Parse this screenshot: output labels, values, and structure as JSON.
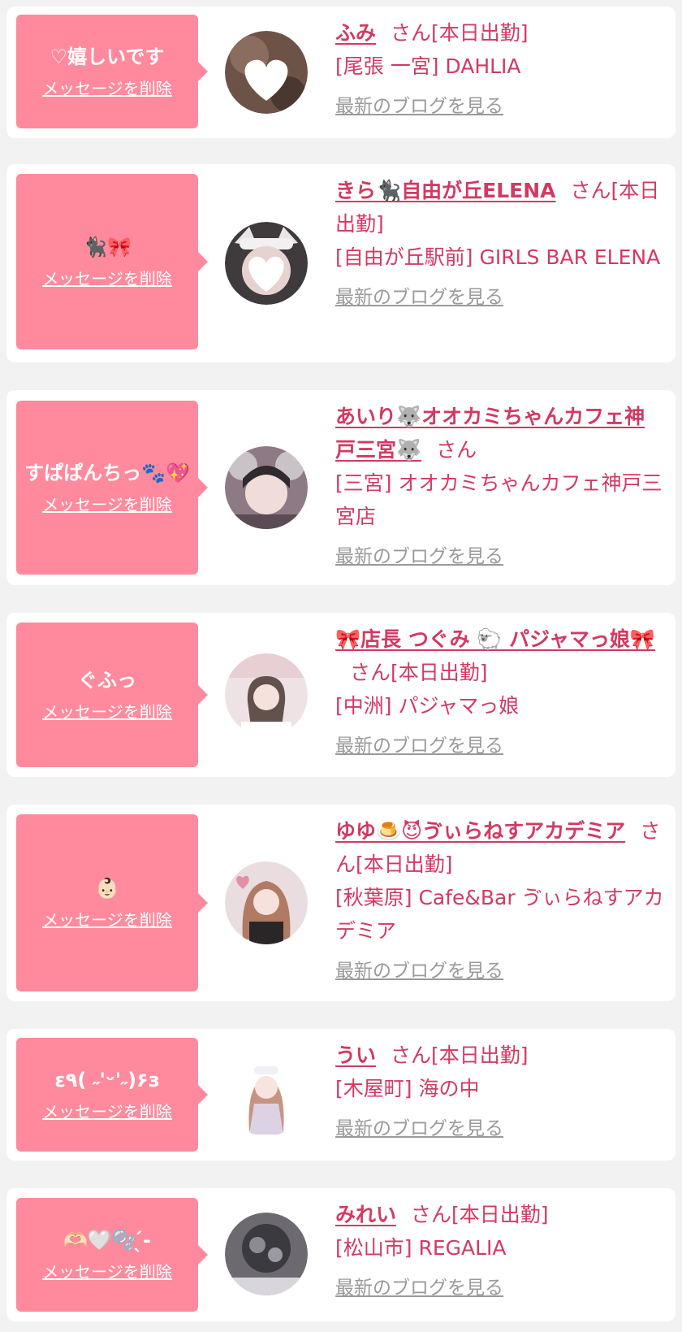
{
  "messages": [
    {
      "message": "♡嬉しいです",
      "delete_label": "メッセージを削除",
      "name": "ふみ",
      "suffix": "さん[本日出勤]",
      "place": "[尾張 一宮] DAHLIA",
      "blog_label": "最新のブログを見る",
      "avatar_color": "#6d5347"
    },
    {
      "message": "🐈‍⬛🎀",
      "delete_label": "メッセージを削除",
      "name": "きら🐈‍⬛自由が丘ELENA",
      "suffix": "さん[本日出勤]",
      "place": "[自由が丘駅前] GIRLS BAR ELENA",
      "blog_label": "最新のブログを見る",
      "avatar_color": "#3f3b3d"
    },
    {
      "message": "すぱぱんちっ🐾💖",
      "delete_label": "メッセージを削除",
      "name": "あいり🐺オオカミちゃんカフェ神戸三宮🐺",
      "suffix": "さん",
      "place": "[三宮] オオカミちゃんカフェ神戸三宮店",
      "blog_label": "最新のブログを見る",
      "avatar_color": "#8e7a84"
    },
    {
      "message": "ぐふっ",
      "delete_label": "メッセージを削除",
      "name": "🎀店長 つぐみ 🐑 パジャマっ娘🎀",
      "suffix": "さん[本日出勤]",
      "place": "[中洲] パジャマっ娘",
      "blog_label": "最新のブログを見る",
      "avatar_color": "#efe2e4"
    },
    {
      "message": "👶🏻",
      "delete_label": "メッセージを削除",
      "name": "ゆゆ🍮😈ゔぃらねすアカデミア",
      "suffix": "さん[本日出勤]",
      "place": "[秋葉原] Cafe&Bar ゔぃらねすアカデミア",
      "blog_label": "最新のブログを見る",
      "avatar_color": "#d9c4c8"
    },
    {
      "message": "ε٩( ˶'ᵕ'˶)۶з",
      "delete_label": "メッセージを削除",
      "name": "うい",
      "suffix": "さん[本日出勤]",
      "place": "[木屋町] 海の中",
      "blog_label": "最新のブログを見る",
      "avatar_color": "#f4f0f2"
    },
    {
      "message": "🫶🏻🤍🫧 ̖́-",
      "delete_label": "メッセージを削除",
      "name": "みれい",
      "suffix": "さん[本日出勤]",
      "place": "[松山市] REGALIA",
      "blog_label": "最新のブログを見る",
      "avatar_color": "#6c6a70"
    }
  ]
}
